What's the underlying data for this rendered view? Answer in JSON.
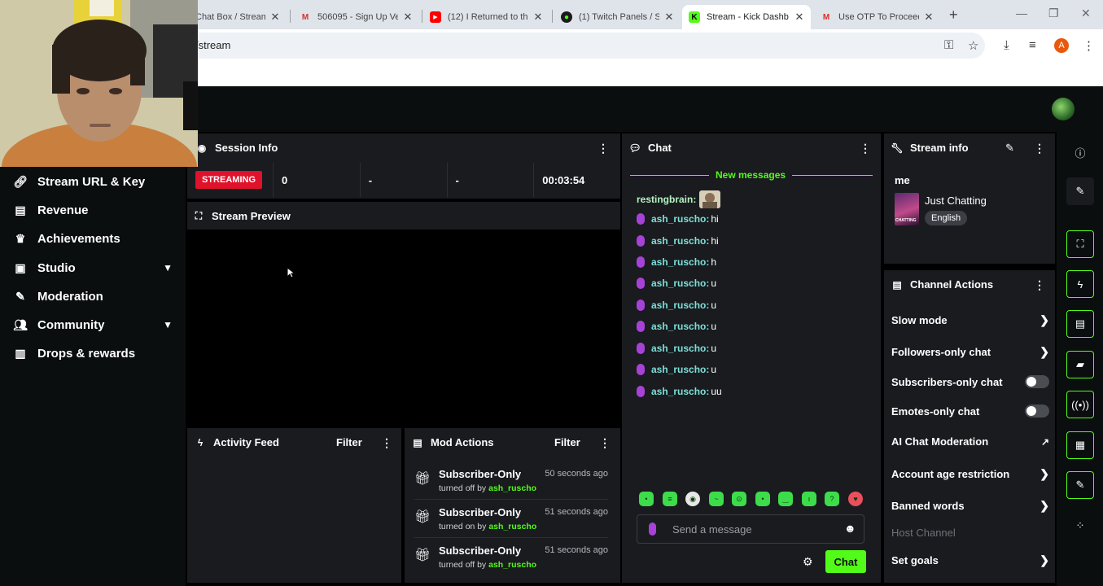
{
  "browser": {
    "tabs": [
      {
        "title": "Chat Box / Stream",
        "favicon": "kick-icon"
      },
      {
        "title": "506095 - Sign Up Ver",
        "favicon": "gmail-icon"
      },
      {
        "title": "(12) I Returned to th",
        "favicon": "youtube-icon"
      },
      {
        "title": "(1) Twitch Panels / St",
        "favicon": "ogame-icon"
      },
      {
        "title": "Stream - Kick Dashb",
        "favicon": "kick-icon"
      },
      {
        "title": "Use OTP To Proceed",
        "favicon": "gmail-icon"
      }
    ],
    "url": "/stream",
    "profile_initial": "A"
  },
  "nav": {
    "items": [
      {
        "label": "Stream URL & Key",
        "icon": "link-icon"
      },
      {
        "label": "Revenue",
        "icon": "chart-icon"
      },
      {
        "label": "Achievements",
        "icon": "trophy-icon"
      },
      {
        "label": "Studio",
        "icon": "studio-icon"
      },
      {
        "label": "Moderation",
        "icon": "wrench-icon"
      },
      {
        "label": "Community",
        "icon": "users-icon"
      },
      {
        "label": "Drops & rewards",
        "icon": "gift-chart-icon"
      }
    ]
  },
  "session": {
    "title": "Session Info",
    "status": "STREAMING",
    "cells": [
      "0",
      "-",
      "-",
      "00:03:54"
    ]
  },
  "preview": {
    "title": "Stream Preview"
  },
  "activity": {
    "title": "Activity Feed",
    "filter": "Filter"
  },
  "mod": {
    "title": "Mod Actions",
    "filter": "Filter",
    "items": [
      {
        "title": "Subscriber-Only",
        "time": "50 seconds ago",
        "action": "turned off by",
        "user": "ash_ruscho"
      },
      {
        "title": "Subscriber-Only",
        "time": "51 seconds ago",
        "action": "turned on by",
        "user": "ash_ruscho"
      },
      {
        "title": "Subscriber-Only",
        "time": "51 seconds ago",
        "action": "turned off by",
        "user": "ash_ruscho"
      }
    ]
  },
  "chat": {
    "title": "Chat",
    "new_messages": "New messages",
    "first_user": "restingbrain:",
    "messages": [
      {
        "user": "ash_ruscho:",
        "text": "hi"
      },
      {
        "user": "ash_ruscho:",
        "text": "hi"
      },
      {
        "user": "ash_ruscho:",
        "text": "h"
      },
      {
        "user": "ash_ruscho:",
        "text": "u"
      },
      {
        "user": "ash_ruscho:",
        "text": "u"
      },
      {
        "user": "ash_ruscho:",
        "text": "u"
      },
      {
        "user": "ash_ruscho:",
        "text": "u"
      },
      {
        "user": "ash_ruscho:",
        "text": "u"
      },
      {
        "user": "ash_ruscho:",
        "text": "uu"
      }
    ],
    "placeholder": "Send a message",
    "send_label": "Chat"
  },
  "stream_info": {
    "title": "Stream info",
    "stream_title": "me",
    "category": "Just Chatting",
    "language": "English",
    "category_thumb_text": "CHATTING"
  },
  "channel_actions": {
    "title": "Channel Actions",
    "items": [
      {
        "label": "Slow mode",
        "control": "arrow"
      },
      {
        "label": "Followers-only chat",
        "control": "arrow"
      },
      {
        "label": "Subscribers-only chat",
        "control": "toggle"
      },
      {
        "label": "Emotes-only chat",
        "control": "toggle"
      },
      {
        "label": "AI Chat Moderation",
        "control": "external"
      },
      {
        "label": "Account age restriction",
        "control": "arrow"
      },
      {
        "label": "Banned words",
        "control": "arrow"
      },
      {
        "label": "Host Channel",
        "control": "none"
      },
      {
        "label": "Set goals",
        "control": "arrow"
      }
    ]
  },
  "colors": {
    "accent": "#53fc18",
    "live": "#e0112b",
    "panel": "#191b1f",
    "background": "#0b0e0f"
  }
}
